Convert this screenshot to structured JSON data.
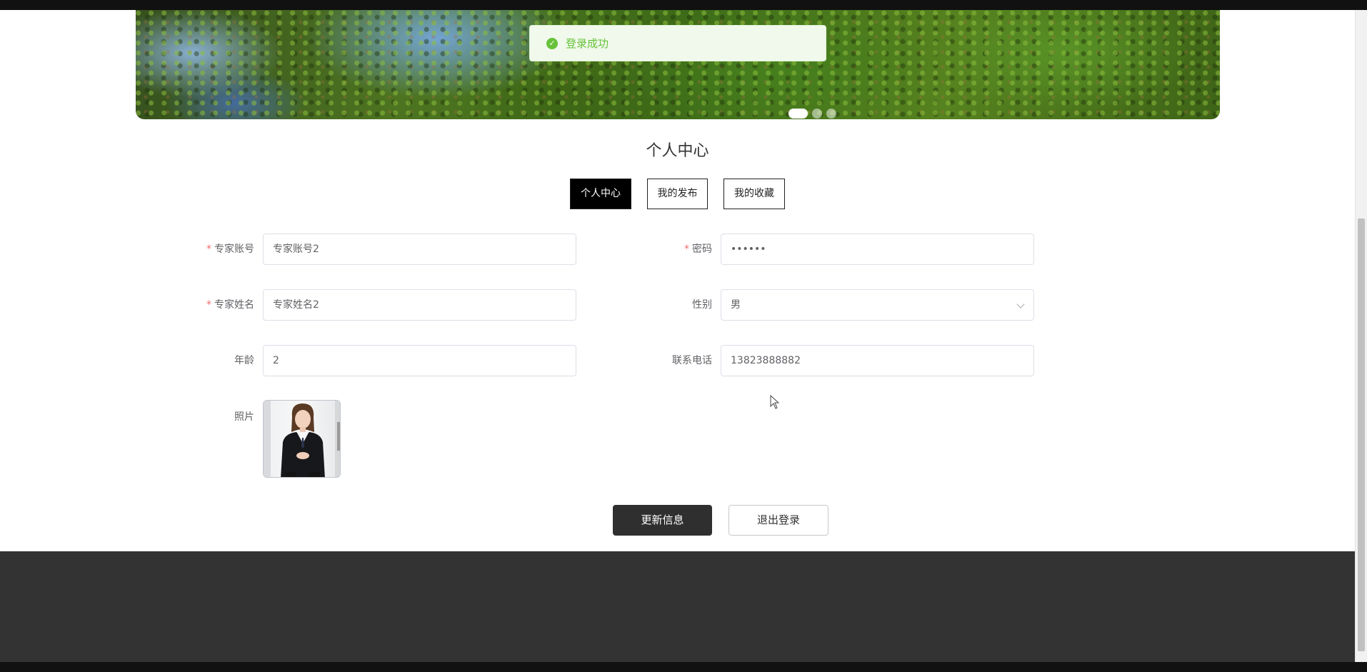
{
  "toast": {
    "message": "登录成功",
    "icon": "check-circle-icon",
    "color": "#67c23a"
  },
  "carousel": {
    "dots": 3,
    "active_index": 0
  },
  "page": {
    "title": "个人中心"
  },
  "tabs": [
    {
      "label": "个人中心",
      "active": true
    },
    {
      "label": "我的发布",
      "active": false
    },
    {
      "label": "我的收藏",
      "active": false
    }
  ],
  "form": {
    "account": {
      "label": "专家账号",
      "required": true,
      "value": "专家账号2"
    },
    "password": {
      "label": "密码",
      "required": true,
      "value": "••••••"
    },
    "name": {
      "label": "专家姓名",
      "required": true,
      "value": "专家姓名2"
    },
    "gender": {
      "label": "性别",
      "required": false,
      "value": "男"
    },
    "age": {
      "label": "年龄",
      "required": false,
      "value": "2"
    },
    "phone": {
      "label": "联系电话",
      "required": false,
      "value": "13823888882"
    },
    "photo": {
      "label": "照片"
    }
  },
  "actions": {
    "update_label": "更新信息",
    "logout_label": "退出登录"
  },
  "theme": {
    "primary_button": "#2f2f2f",
    "footer": "#333333",
    "required_star": "#f56c6c"
  }
}
